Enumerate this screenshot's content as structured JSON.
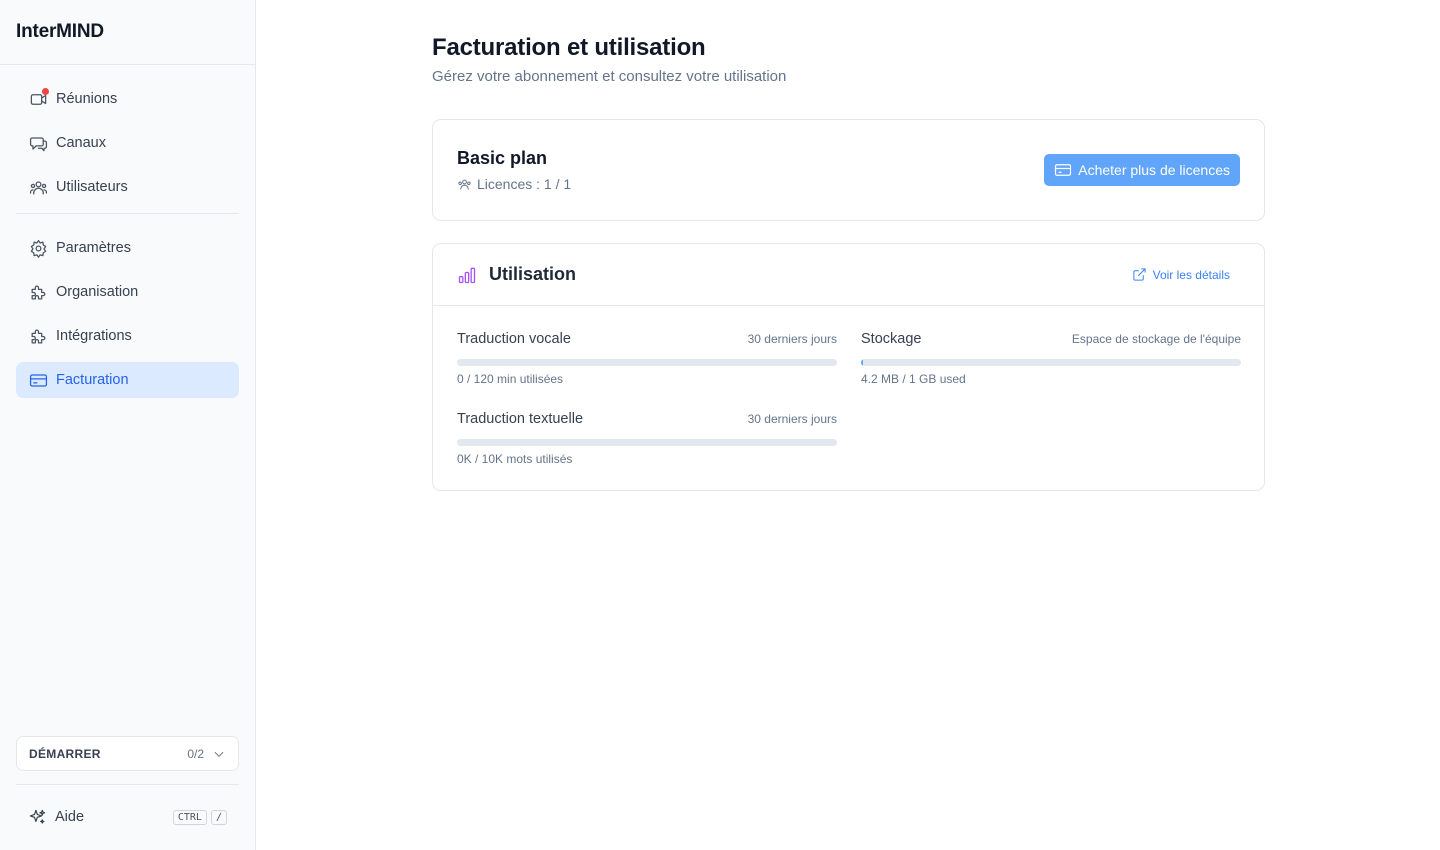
{
  "app": {
    "name": "InterMIND"
  },
  "sidebar": {
    "items": [
      {
        "label": "Réunions",
        "icon": "video-icon",
        "active": false,
        "notification": true
      },
      {
        "label": "Canaux",
        "icon": "chat-icon",
        "active": false
      },
      {
        "label": "Utilisateurs",
        "icon": "users-icon",
        "active": false
      },
      {
        "label": "Paramètres",
        "icon": "gear-icon",
        "active": false
      },
      {
        "label": "Organisation",
        "icon": "puzzle-icon",
        "active": false
      },
      {
        "label": "Intégrations",
        "icon": "puzzle-icon",
        "active": false
      },
      {
        "label": "Facturation",
        "icon": "credit-card-icon",
        "active": true
      }
    ],
    "getting_started": {
      "label": "DÉMARRER",
      "progress": "0/2"
    },
    "help": {
      "label": "Aide",
      "shortcut_keys": [
        "CTRL",
        "/"
      ]
    }
  },
  "page": {
    "title": "Facturation et utilisation",
    "subtitle": "Gérez votre abonnement et consultez votre utilisation"
  },
  "plan": {
    "name": "Basic plan",
    "licenses": "Licences : 1 / 1",
    "buy_button": "Acheter plus de licences"
  },
  "usage": {
    "title": "Utilisation",
    "details_link": "Voir les détails",
    "metrics": [
      {
        "name": "Traduction vocale",
        "period": "30 derniers jours",
        "usage": "0 / 120 min utilisées",
        "fraction": 0
      },
      {
        "name": "Stockage",
        "period": "Espace de stockage de l'équipe",
        "usage": "4.2 MB / 1 GB used",
        "fraction": 0.004
      },
      {
        "name": "Traduction textuelle",
        "period": "30 derniers jours",
        "usage": "0K / 10K mots utilisés",
        "fraction": 0
      }
    ]
  },
  "colors": {
    "accent": "#2563eb",
    "button": "#60a5fa",
    "active_bg": "#dbeafe",
    "chart_icon": "#a855f7",
    "notification": "#ef4444"
  }
}
